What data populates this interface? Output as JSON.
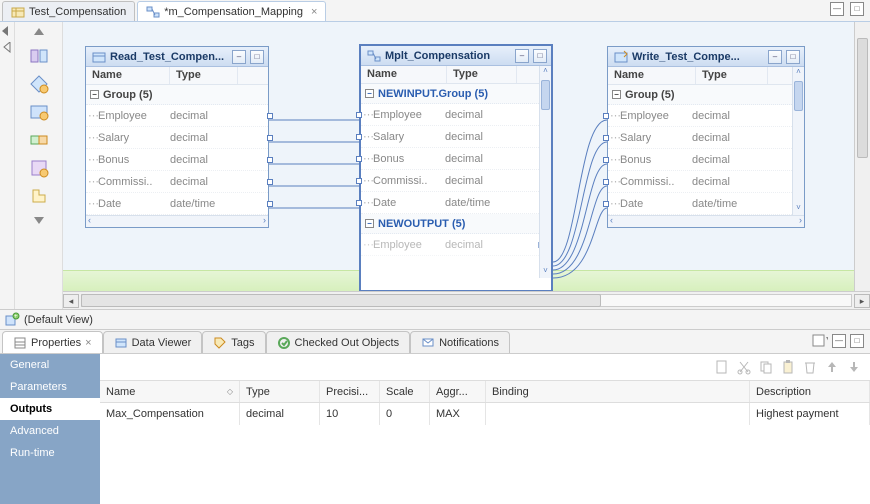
{
  "editor_tabs": {
    "t0": "Test_Compensation",
    "t1": "*m_Compensation_Mapping",
    "close_glyph": "×"
  },
  "canvas": {
    "cols": {
      "name": "Name",
      "type": "Type"
    },
    "tx_read": {
      "title": "Read_Test_Compen...",
      "group": "Group (5)",
      "fields": [
        {
          "name": "Employee",
          "type": "decimal"
        },
        {
          "name": "Salary",
          "type": "decimal"
        },
        {
          "name": "Bonus",
          "type": "decimal"
        },
        {
          "name": "Commissi..",
          "type": "decimal"
        },
        {
          "name": "Date",
          "type": "date/time"
        }
      ]
    },
    "tx_mplt": {
      "title": "Mplt_Compensation",
      "group_in": "NEWINPUT.Group (5)",
      "group_out": "NEWOUTPUT (5)",
      "fields": [
        {
          "name": "Employee",
          "type": "decimal"
        },
        {
          "name": "Salary",
          "type": "decimal"
        },
        {
          "name": "Bonus",
          "type": "decimal"
        },
        {
          "name": "Commissi..",
          "type": "decimal"
        },
        {
          "name": "Date",
          "type": "date/time"
        }
      ],
      "out_first": {
        "name": "Employee",
        "type": "decimal"
      }
    },
    "tx_write": {
      "title": "Write_Test_Compe...",
      "group": "Group (5)",
      "fields": [
        {
          "name": "Employee",
          "type": "decimal"
        },
        {
          "name": "Salary",
          "type": "decimal"
        },
        {
          "name": "Bonus",
          "type": "decimal"
        },
        {
          "name": "Commissi..",
          "type": "decimal"
        },
        {
          "name": "Date",
          "type": "date/time"
        }
      ]
    }
  },
  "viewbar": {
    "label": "(Default View)"
  },
  "bottom_tabs": {
    "t0": "Properties",
    "t1": "Data Viewer",
    "t2": "Tags",
    "t3": "Checked Out Objects",
    "t4": "Notifications"
  },
  "prop_side": {
    "p0": "General",
    "p1": "Parameters",
    "p2": "Outputs",
    "p3": "Advanced",
    "p4": "Run-time"
  },
  "grid": {
    "head": {
      "name": "Name",
      "type": "Type",
      "prec": "Precisi...",
      "scale": "Scale",
      "aggr": "Aggr...",
      "bind": "Binding",
      "desc": "Description"
    },
    "row0": {
      "name": "Max_Compensation",
      "type": "decimal",
      "prec": "10",
      "scale": "0",
      "aggr": "MAX",
      "bind": "",
      "desc": "Highest payment"
    }
  },
  "glyph": {
    "expand": "⊟",
    "left": "‹",
    "right": "›",
    "up": "˄",
    "down": "˅",
    "tri_r": "▸",
    "tri_d": "▾",
    "min": "—",
    "max": "□"
  }
}
